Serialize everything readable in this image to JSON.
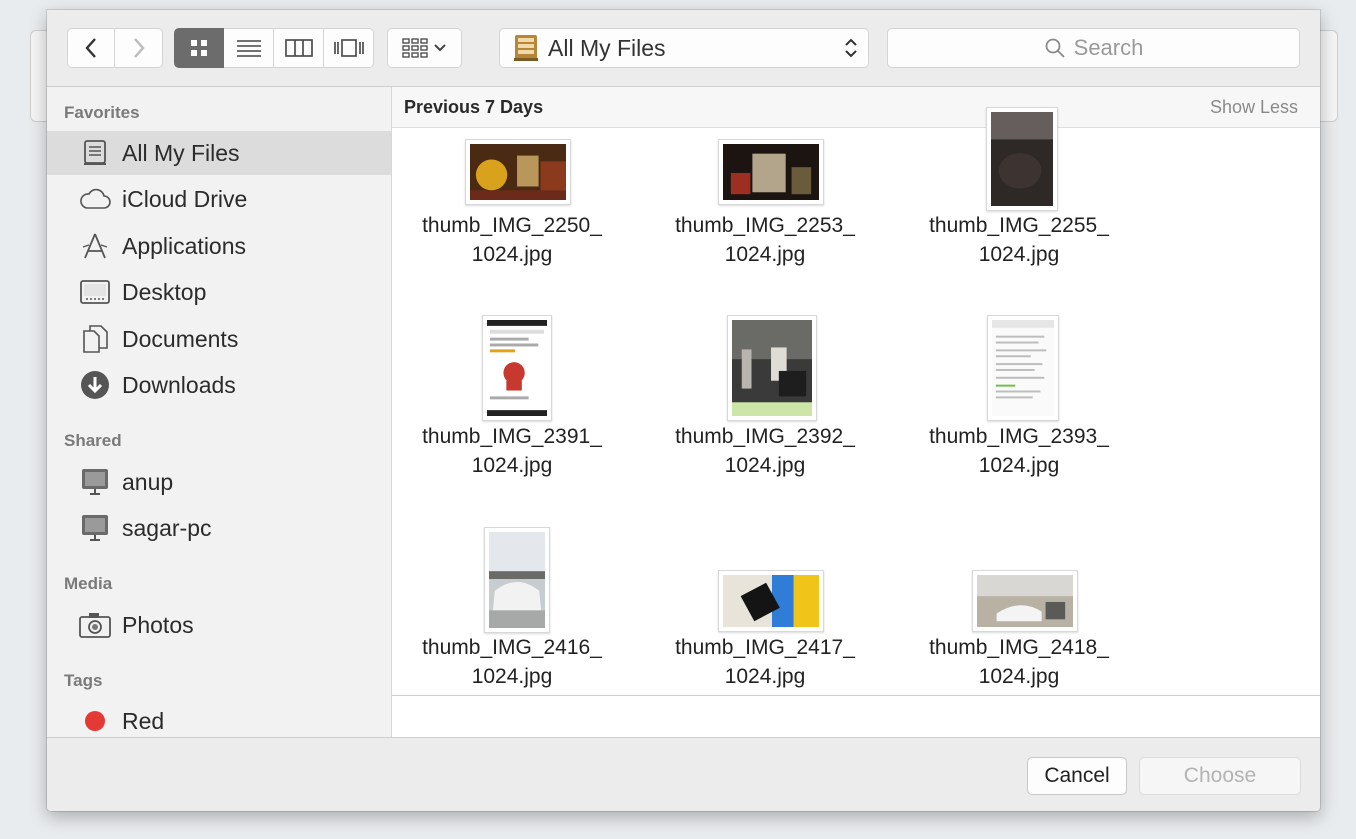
{
  "toolbar": {
    "location": "All My Files",
    "search_placeholder": "Search"
  },
  "sidebar": {
    "sections": [
      {
        "title": "Favorites"
      },
      {
        "title": "Shared"
      },
      {
        "title": "Media"
      },
      {
        "title": "Tags"
      }
    ],
    "favorites": [
      "All My Files",
      "iCloud Drive",
      "Applications",
      "Desktop",
      "Documents",
      "Downloads"
    ],
    "shared": [
      "anup",
      "sagar-pc"
    ],
    "media": [
      "Photos"
    ],
    "tags": [
      {
        "label": "Red",
        "color": "#e53935"
      }
    ]
  },
  "content": {
    "group_title": "Previous 7 Days",
    "show_less": "Show Less",
    "files": [
      {
        "line1": "thumb_IMG_2250_",
        "line2": "1024.jpg"
      },
      {
        "line1": "thumb_IMG_2253_",
        "line2": "1024.jpg"
      },
      {
        "line1": "thumb_IMG_2255_",
        "line2": "1024.jpg"
      },
      {
        "line1": "thumb_IMG_2391_",
        "line2": "1024.jpg"
      },
      {
        "line1": "thumb_IMG_2392_",
        "line2": "1024.jpg"
      },
      {
        "line1": "thumb_IMG_2393_",
        "line2": "1024.jpg"
      },
      {
        "line1": "thumb_IMG_2416_",
        "line2": "1024.jpg"
      },
      {
        "line1": "thumb_IMG_2417_",
        "line2": "1024.jpg"
      },
      {
        "line1": "thumb_IMG_2418_",
        "line2": "1024.jpg"
      }
    ]
  },
  "footer": {
    "cancel": "Cancel",
    "choose": "Choose"
  },
  "colors": {
    "selected_segment": "#6c6c6c",
    "tag_red": "#e53935"
  }
}
